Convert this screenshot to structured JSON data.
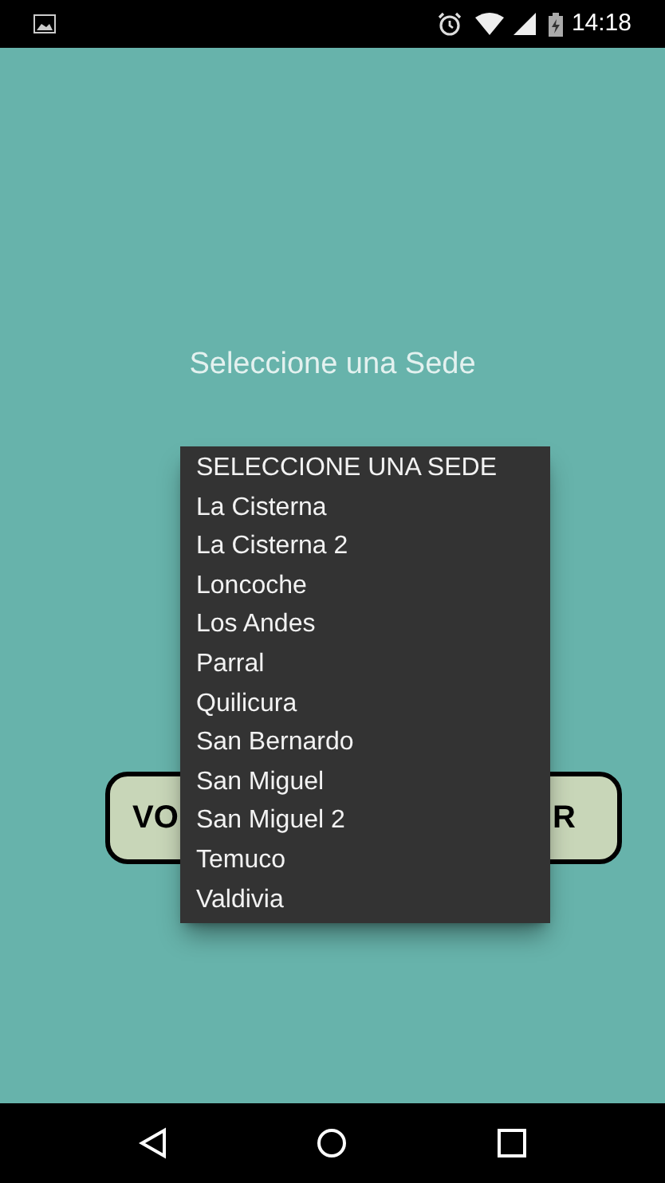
{
  "status_bar": {
    "time": "14:18"
  },
  "prompt": "Seleccione una Sede",
  "button": {
    "text_left": "VO",
    "text_right": "R"
  },
  "dropdown": {
    "items": [
      "SELECCIONE UNA SEDE",
      "La Cisterna",
      "La Cisterna 2",
      "Loncoche",
      "Los Andes",
      "Parral",
      "Quilicura",
      "San Bernardo",
      "San Miguel",
      "San Miguel 2",
      "Temuco",
      "Valdivia"
    ]
  }
}
